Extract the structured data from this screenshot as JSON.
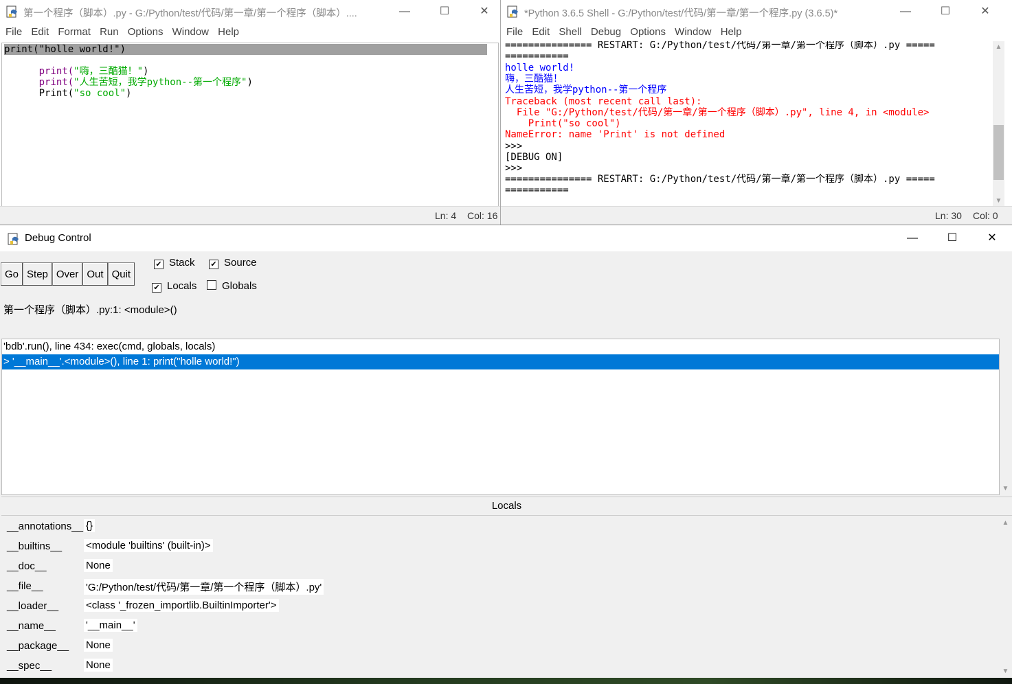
{
  "editor": {
    "title": "第一个程序（脚本）.py - G:/Python/test/代码/第一章/第一个程序（脚本）....",
    "menu": [
      "File",
      "Edit",
      "Format",
      "Run",
      "Options",
      "Window",
      "Help"
    ],
    "status": {
      "ln": "Ln: 4",
      "col": "Col: 16"
    },
    "code": {
      "line1": "print(\"holle world!\")",
      "line2_kw": "print(",
      "line2_str": "\"嗨，三酷猫！\"",
      "line2_end": ")",
      "line3_kw": "print(",
      "line3_str": "\"人生苦短，我学python--第一个程序\"",
      "line3_end": ")",
      "line4_kw": "Print(",
      "line4_str": "\"so cool\"",
      "line4_end": ")"
    }
  },
  "shell": {
    "title": "*Python 3.6.5 Shell - G:/Python/test/代码/第一章/第一个程序.py (3.6.5)*",
    "menu": [
      "File",
      "Edit",
      "Shell",
      "Debug",
      "Options",
      "Window",
      "Help"
    ],
    "status": {
      "ln": "Ln: 30",
      "col": "Col: 0"
    },
    "lines": {
      "restart1": "=============== RESTART: G:/Python/test/代码/第一章/第一个程序（脚本）.py =====",
      "eq1": "===========",
      "out1": "holle world!",
      "out2": "嗨，三酷猫！",
      "out3": "人生苦短，我学python--第一个程序",
      "tb1": "Traceback (most recent call last):",
      "tb2": "  File \"G:/Python/test/代码/第一章/第一个程序（脚本）.py\", line 4, in <module>",
      "tb3": "    Print(\"so cool\")",
      "tb4": "NameError: name 'Print' is not defined",
      "prompt1": ">>>",
      "debug": "[DEBUG ON]",
      "prompt2": ">>>",
      "restart2": "=============== RESTART: G:/Python/test/代码/第一章/第一个程序（脚本）.py =====",
      "eq2": "==========="
    }
  },
  "debug": {
    "title": "Debug Control",
    "buttons": {
      "go": "Go",
      "step": "Step",
      "over": "Over",
      "out": "Out",
      "quit": "Quit"
    },
    "checks": {
      "stack": {
        "label": "Stack",
        "checked": true
      },
      "source": {
        "label": "Source",
        "checked": true
      },
      "locals": {
        "label": "Locals",
        "checked": true
      },
      "globals": {
        "label": "Globals",
        "checked": false
      }
    },
    "status": "第一个程序（脚本）.py:1: <module>()",
    "stack": {
      "line1": "'bdb'.run(), line 434: exec(cmd, globals, locals)",
      "line2": "> '__main__'.<module>(), line 1: print(\"holle world!\")"
    },
    "locals_header": "Locals",
    "locals": [
      {
        "name": "__annotations__",
        "value": "{}"
      },
      {
        "name": "__builtins__",
        "value": "<module 'builtins' (built-in)>"
      },
      {
        "name": "__doc__",
        "value": "None"
      },
      {
        "name": "__file__",
        "value": "'G:/Python/test/代码/第一章/第一个程序（脚本）.py'"
      },
      {
        "name": "__loader__",
        "value": "<class '_frozen_importlib.BuiltinImporter'>"
      },
      {
        "name": "__name__",
        "value": "'__main__'"
      },
      {
        "name": "__package__",
        "value": "None"
      },
      {
        "name": "__spec__",
        "value": "None"
      }
    ]
  },
  "colors": {
    "keyword": "#800080",
    "string": "#00aa00",
    "stdout": "#0000ff",
    "stderr": "#ff0000",
    "selection": "#0078d7",
    "current_line": "#a0a0a0"
  }
}
